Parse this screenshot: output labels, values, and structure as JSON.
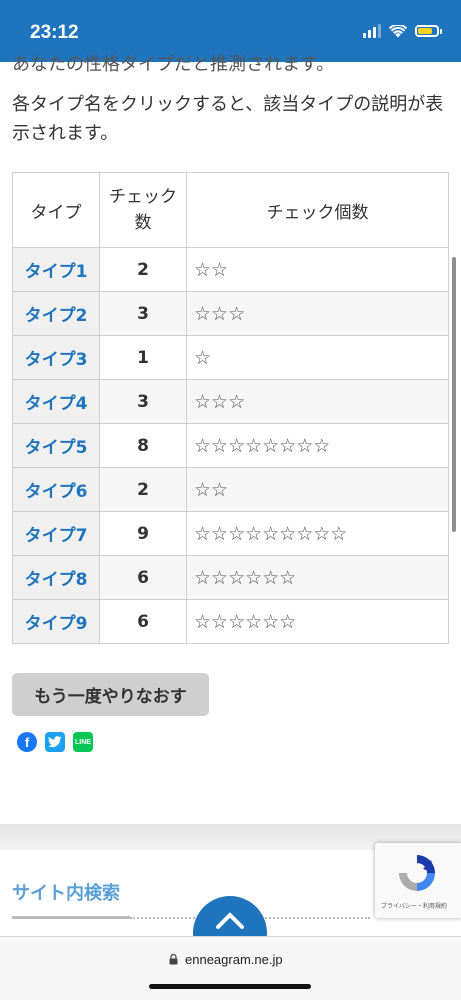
{
  "status_bar": {
    "time": "23:12",
    "icons": [
      "signal-icon",
      "wifi-icon",
      "battery-icon"
    ],
    "battery_color": "#f6d31b"
  },
  "cut_text": "あなたの性格タイプだと推測されます。",
  "description": "各タイプ名をクリックすると、該当タイプの説明が表示されます。",
  "table": {
    "headers": {
      "type": "タイプ",
      "count": "チェック数",
      "stars": "チェック個数"
    },
    "rows": [
      {
        "type": "タイプ1",
        "count": "2",
        "stars": "☆☆"
      },
      {
        "type": "タイプ2",
        "count": "3",
        "stars": "☆☆☆"
      },
      {
        "type": "タイプ3",
        "count": "1",
        "stars": "☆"
      },
      {
        "type": "タイプ4",
        "count": "3",
        "stars": "☆☆☆"
      },
      {
        "type": "タイプ5",
        "count": "8",
        "stars": "☆☆☆☆☆☆☆☆"
      },
      {
        "type": "タイプ6",
        "count": "2",
        "stars": "☆☆"
      },
      {
        "type": "タイプ7",
        "count": "9",
        "stars": "☆☆☆☆☆☆☆☆☆"
      },
      {
        "type": "タイプ8",
        "count": "6",
        "stars": "☆☆☆☆☆☆"
      },
      {
        "type": "タイプ9",
        "count": "6",
        "stars": "☆☆☆☆☆☆"
      }
    ]
  },
  "retry_button": "もう一度やりなおす",
  "share": {
    "icons": [
      "facebook-icon",
      "twitter-icon",
      "line-icon"
    ],
    "line_label": "LINE"
  },
  "site_search": "サイト内検索",
  "recaptcha_text": "プライバシー・利用規約",
  "url": "enneagram.ne.jp",
  "colors": {
    "accent": "#1e74bd",
    "search_title": "#5aa0d8"
  }
}
